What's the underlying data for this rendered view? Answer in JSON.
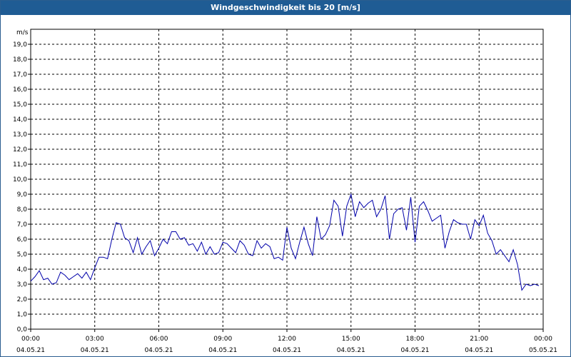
{
  "window": {
    "title": "Windgeschwindigkeit bis 20 [m/s]"
  },
  "colors": {
    "titlebar": "#1f5c94",
    "line": "#0000aa",
    "grid": "#000000"
  },
  "chart_data": {
    "type": "line",
    "title": "Windgeschwindigkeit bis 20 [m/s]",
    "ylabel": "m/s",
    "ylim": [
      0,
      20
    ],
    "xlim_hours": [
      0,
      24
    ],
    "grid": true,
    "y_ticks": [
      "0,0",
      "1,0",
      "2,0",
      "3,0",
      "4,0",
      "5,0",
      "6,0",
      "7,0",
      "8,0",
      "9,0",
      "10,0",
      "11,0",
      "12,0",
      "13,0",
      "14,0",
      "15,0",
      "16,0",
      "17,0",
      "18,0",
      "19,0"
    ],
    "x_ticks": [
      {
        "time": "00:00",
        "date": "04.05.21"
      },
      {
        "time": "03:00",
        "date": "04.05.21"
      },
      {
        "time": "06:00",
        "date": "04.05.21"
      },
      {
        "time": "09:00",
        "date": "04.05.21"
      },
      {
        "time": "12:00",
        "date": "04.05.21"
      },
      {
        "time": "15:00",
        "date": "04.05.21"
      },
      {
        "time": "18:00",
        "date": "04.05.21"
      },
      {
        "time": "21:00",
        "date": "04.05.21"
      },
      {
        "time": "00:00",
        "date": "05.05.21"
      }
    ],
    "series": [
      {
        "x": [
          0.0,
          0.2,
          0.4,
          0.6,
          0.8,
          1.0,
          1.2,
          1.4,
          1.6,
          1.8,
          2.0,
          2.2,
          2.4,
          2.6,
          2.8,
          3.0,
          3.2,
          3.4,
          3.6,
          3.8,
          4.0,
          4.2,
          4.4,
          4.6,
          4.8,
          5.0,
          5.2,
          5.4,
          5.6,
          5.8,
          6.0,
          6.2,
          6.4,
          6.6,
          6.8,
          7.0,
          7.2,
          7.4,
          7.6,
          7.8,
          8.0,
          8.2,
          8.4,
          8.6,
          8.8,
          9.0,
          9.2,
          9.4,
          9.6,
          9.8,
          10.0,
          10.2,
          10.4,
          10.6,
          10.8,
          11.0,
          11.2,
          11.4,
          11.6,
          11.8,
          12.0,
          12.2,
          12.4,
          12.6,
          12.8,
          13.0,
          13.2,
          13.4,
          13.6,
          13.8,
          14.0,
          14.2,
          14.4,
          14.6,
          14.8,
          15.0,
          15.2,
          15.4,
          15.6,
          15.8,
          16.0,
          16.2,
          16.4,
          16.6,
          16.8,
          17.0,
          17.2,
          17.4,
          17.6,
          17.8,
          18.0,
          18.2,
          18.4,
          18.6,
          18.8,
          19.0,
          19.2,
          19.4,
          19.6,
          19.8,
          20.0,
          20.2,
          20.4,
          20.6,
          20.8,
          21.0,
          21.2,
          21.4,
          21.6,
          21.8,
          22.0,
          22.2,
          22.4,
          22.6,
          22.8,
          23.0,
          23.2,
          23.4,
          23.6,
          23.8
        ],
        "y": [
          3.2,
          3.5,
          3.9,
          3.3,
          3.4,
          3.0,
          3.1,
          3.8,
          3.6,
          3.3,
          3.5,
          3.7,
          3.4,
          3.8,
          3.3,
          4.1,
          4.8,
          4.8,
          4.7,
          6.0,
          7.1,
          7.0,
          6.1,
          5.9,
          5.1,
          6.1,
          5.0,
          5.5,
          5.9,
          4.9,
          5.4,
          6.0,
          5.7,
          6.5,
          6.5,
          6.0,
          6.1,
          5.6,
          5.7,
          5.2,
          5.8,
          5.0,
          5.5,
          5.0,
          5.1,
          5.8,
          5.7,
          5.4,
          5.1,
          5.9,
          5.6,
          5.0,
          4.9,
          5.9,
          5.4,
          5.7,
          5.5,
          4.7,
          4.8,
          4.6,
          6.8,
          5.4,
          4.7,
          5.8,
          6.8,
          5.7,
          4.9,
          7.5,
          6.0,
          6.3,
          6.9,
          8.6,
          8.2,
          6.2,
          8.2,
          9.0,
          7.5,
          8.5,
          8.1,
          8.4,
          8.6,
          7.5,
          8.0,
          8.9,
          6.0,
          7.7,
          8.0,
          8.1,
          6.6,
          8.8,
          5.8,
          8.2,
          8.5,
          7.9,
          7.2,
          7.4,
          7.6,
          5.4,
          6.5,
          7.3,
          7.1,
          7.0,
          7.0,
          6.0,
          7.3,
          6.9,
          7.6,
          6.4,
          5.9,
          5.0,
          5.3,
          4.9,
          4.5,
          5.3,
          4.3,
          2.6,
          3.0,
          2.9,
          3.0,
          2.9
        ]
      }
    ]
  }
}
